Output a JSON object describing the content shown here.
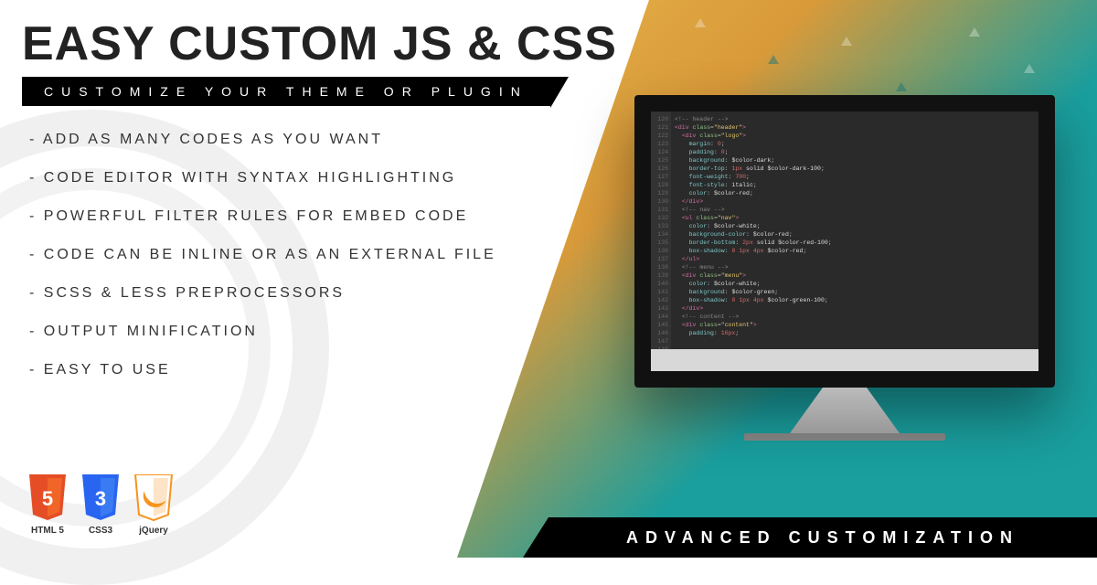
{
  "header": {
    "title": "EASY CUSTOM JS & CSS",
    "subtitle": "CUSTOMIZE YOUR THEME OR PLUGIN"
  },
  "features": [
    "ADD AS MANY CODES AS YOU WANT",
    "CODE EDITOR WITH SYNTAX HIGHLIGHTING",
    "POWERFUL FILTER RULES FOR EMBED CODE",
    "CODE CAN BE INLINE OR AS AN EXTERNAL FILE",
    "SCSS & LESS PREPROCESSORS",
    "OUTPUT MINIFICATION",
    "EASY TO USE"
  ],
  "badges": [
    {
      "label": "HTML 5",
      "color": "#e44d26",
      "glyph": "5"
    },
    {
      "label": "CSS3",
      "color": "#2965f1",
      "glyph": "3"
    },
    {
      "label": "jQuery",
      "color": "#f7941d",
      "glyph": "jQuery"
    }
  ],
  "footer": {
    "text": "ADVANCED CUSTOMIZATION"
  },
  "editor": {
    "line_start": 120,
    "line_count": 32
  }
}
